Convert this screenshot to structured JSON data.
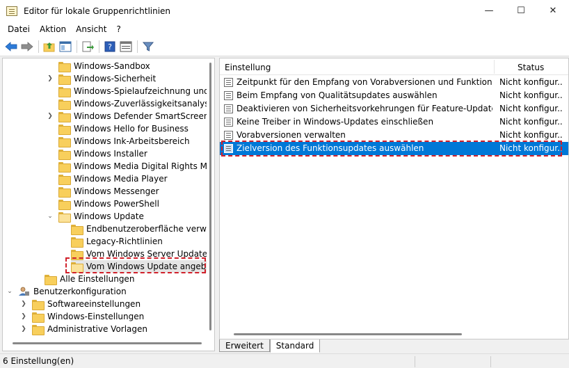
{
  "window": {
    "title": "Editor für lokale Gruppenrichtlinien",
    "minimize": "—",
    "maximize": "☐",
    "close": "✕"
  },
  "menu": {
    "file": "Datei",
    "action": "Aktion",
    "view": "Ansicht",
    "help": "?"
  },
  "tree": {
    "items": [
      {
        "label": "Windows-Sandbox"
      },
      {
        "label": "Windows-Sicherheit"
      },
      {
        "label": "Windows-Spielaufzeichnung und -ü"
      },
      {
        "label": "Windows-Zuverlässigkeitsanalyse"
      },
      {
        "label": "Windows Defender SmartScreen"
      },
      {
        "label": "Windows Hello for Business"
      },
      {
        "label": "Windows Ink-Arbeitsbereich"
      },
      {
        "label": "Windows Installer"
      },
      {
        "label": "Windows Media Digital Rights Mana"
      },
      {
        "label": "Windows Media Player"
      },
      {
        "label": "Windows Messenger"
      },
      {
        "label": "Windows PowerShell"
      },
      {
        "label": "Windows Update"
      },
      {
        "label": "Endbenutzeroberfläche verwalten"
      },
      {
        "label": "Legacy-Richtlinien"
      },
      {
        "label": "Vom Windows Server Update Ser"
      },
      {
        "label": "Vom Windows Update angebote"
      },
      {
        "label": "Alle Einstellungen"
      },
      {
        "label": "Benutzerkonfiguration"
      },
      {
        "label": "Softwareeinstellungen"
      },
      {
        "label": "Windows-Einstellungen"
      },
      {
        "label": "Administrative Vorlagen"
      }
    ]
  },
  "list": {
    "col_setting": "Einstellung",
    "col_status": "Status",
    "rows": [
      {
        "name": "Zeitpunkt für den Empfang von Vorabversionen und Funktionsupdat...",
        "status": "Nicht konfigur..."
      },
      {
        "name": "Beim Empfang von Qualitätsupdates auswählen",
        "status": "Nicht konfigur..."
      },
      {
        "name": "Deaktivieren von Sicherheitsvorkehrungen für Feature-Updates",
        "status": "Nicht konfigur..."
      },
      {
        "name": "Keine Treiber in Windows-Updates einschließen",
        "status": "Nicht konfigur..."
      },
      {
        "name": "Vorabversionen verwalten",
        "status": "Nicht konfigur..."
      },
      {
        "name": "Zielversion des Funktionsupdates auswählen",
        "status": "Nicht konfigur..."
      }
    ]
  },
  "tabs": {
    "extended": "Erweitert",
    "standard": "Standard"
  },
  "statusbar": {
    "text": "6 Einstellung(en)"
  },
  "colors": {
    "selection": "#0078d7",
    "highlight": "#d0202a",
    "folder": "#f8cf5c"
  }
}
